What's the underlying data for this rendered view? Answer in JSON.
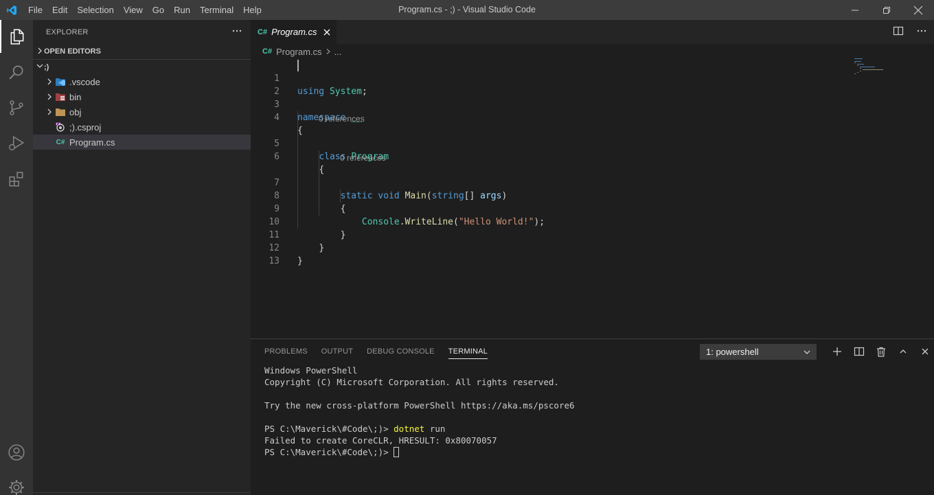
{
  "window": {
    "title": "Program.cs - ;) - Visual Studio Code"
  },
  "menu": [
    "File",
    "Edit",
    "Selection",
    "View",
    "Go",
    "Run",
    "Terminal",
    "Help"
  ],
  "sidebar": {
    "header": "EXPLORER",
    "open_editors": "OPEN EDITORS",
    "folder": ";)",
    "items": [
      {
        "label": ".vscode",
        "type": "folder",
        "icon": "vscode-folder-icon"
      },
      {
        "label": "bin",
        "type": "folder",
        "icon": "bin-folder-icon"
      },
      {
        "label": "obj",
        "type": "folder",
        "icon": "folder-icon"
      },
      {
        "label": ";).csproj",
        "type": "file",
        "icon": "csproj-file-icon"
      },
      {
        "label": "Program.cs",
        "type": "file",
        "icon": "csharp-file-icon",
        "selected": true
      }
    ]
  },
  "editor": {
    "tab_label": "Program.cs",
    "tab_icon_text": "C#",
    "breadcrumb": {
      "file": "Program.cs",
      "tail": "..."
    },
    "codelens": "0 references",
    "line_numbers": [
      "1",
      "2",
      "3",
      "4",
      "5",
      "6",
      "7",
      "8",
      "9",
      "10",
      "11",
      "12",
      "13"
    ],
    "code": {
      "l1_kw": "using",
      "l1_ns": "System",
      "l1_end": ";",
      "l3_kw": "namespace",
      "l3_name": "__",
      "l4": "{",
      "l5_kw": "class",
      "l5_name": "Program",
      "l6": "{",
      "l7_kw1": "static",
      "l7_kw2": "void",
      "l7_fn": "Main",
      "l7_p1": "(",
      "l7_type": "string",
      "l7_p2": "[] ",
      "l7_arg": "args",
      "l7_p3": ")",
      "l8": "{",
      "l9_cls": "Console",
      "l9_dot": ".",
      "l9_fn": "WriteLine",
      "l9_p1": "(",
      "l9_str": "\"Hello World!\"",
      "l9_p2": ");",
      "l10": "}",
      "l11": "}",
      "l12": "}"
    }
  },
  "panel": {
    "tabs": [
      "PROBLEMS",
      "OUTPUT",
      "DEBUG CONSOLE",
      "TERMINAL"
    ],
    "active_tab": "TERMINAL",
    "terminal_select": "1: powershell",
    "terminal": {
      "line1": "Windows PowerShell",
      "line2": "Copyright (C) Microsoft Corporation. All rights reserved.",
      "line3": "Try the new cross-platform PowerShell https://aka.ms/pscore6",
      "prompt": "PS C:\\Maverick\\#Code\\;)> ",
      "command": "dotnet",
      "command_args": " run",
      "error": "Failed to create CoreCLR, HRESULT: 0x80070057"
    }
  },
  "colors": {
    "keyword": "#569cd6",
    "type": "#4ec9b0",
    "function": "#dcdcaa",
    "string": "#ce9178",
    "parameter": "#9cdcfe",
    "vscode_blue": "#23a9f2"
  }
}
